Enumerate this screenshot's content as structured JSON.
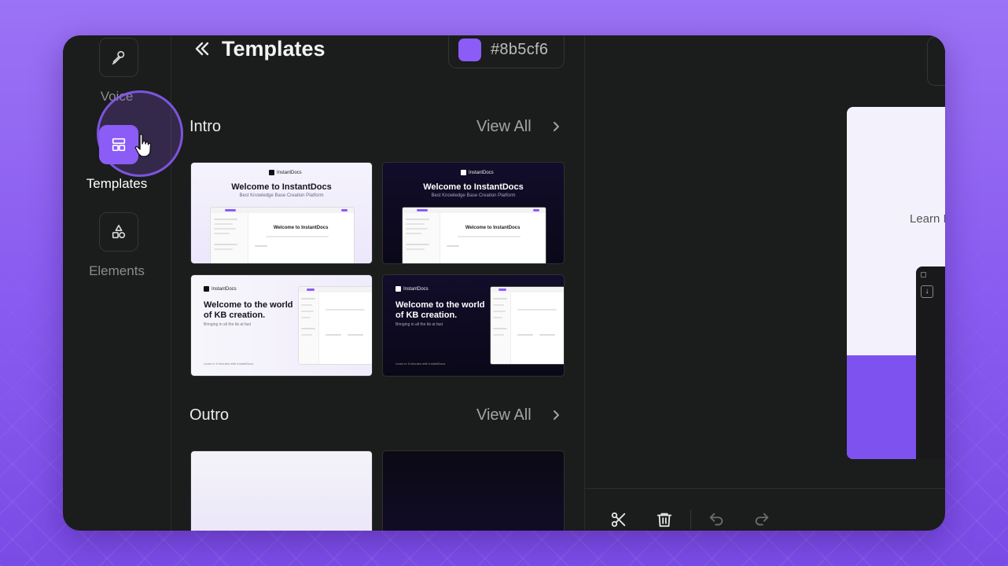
{
  "sidebar": {
    "items": [
      {
        "label": "Voice",
        "icon": "microphone-icon"
      },
      {
        "label": "Templates",
        "icon": "layout-icon"
      },
      {
        "label": "Elements",
        "icon": "shapes-icon"
      }
    ]
  },
  "panel": {
    "title": "Templates",
    "color_hex": "#8b5cf6",
    "sections": [
      {
        "title": "Intro",
        "view_all": "View All"
      },
      {
        "title": "Outro",
        "view_all": "View All"
      }
    ]
  },
  "templates": {
    "brand": "InstantDocs",
    "welcome_title": "Welcome to InstantDocs",
    "welcome_sub": "Best Knowledge Base Creation Platform",
    "mock_title": "Welcome to InstantDocs",
    "kb_title": "Welcome to the world of KB creation.",
    "kb_sub": "Bringing in all the kb at fast",
    "kb_foot": "Learn in 5 minutes with InstantDocs"
  },
  "preview": {
    "text": "Learn I"
  },
  "colors": {
    "accent": "#8b5cf6",
    "panel_bg": "#1b1c1c",
    "page_bg": "#8a5cf0"
  }
}
